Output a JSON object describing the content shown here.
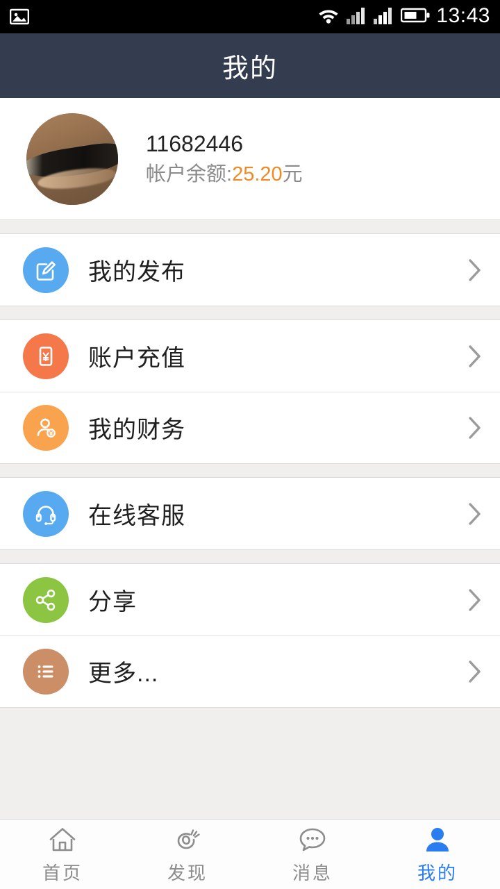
{
  "status_bar": {
    "time": "13:43",
    "icons": [
      "photo-icon",
      "wifi-icon",
      "signal-icon-1",
      "signal-icon-2",
      "battery-icon"
    ]
  },
  "header": {
    "title": "我的"
  },
  "profile": {
    "avatar_alt": "user-avatar-photo",
    "username": "11682446",
    "balance_label": "帐户余额:",
    "balance_amount": "25.20",
    "balance_unit": "元",
    "balance_color": "#f08a24"
  },
  "menu_groups": [
    {
      "items": [
        {
          "label": "我的发布",
          "icon": "edit-document-icon",
          "color": "#58aaf0",
          "chevron": "chevron-right-icon"
        }
      ]
    },
    {
      "items": [
        {
          "label": "账户充值",
          "icon": "yuan-note-icon",
          "color": "#f4784a",
          "chevron": "chevron-right-icon"
        },
        {
          "label": "我的财务",
          "icon": "user-coin-icon",
          "color": "#f9a34e",
          "chevron": "chevron-right-icon"
        }
      ]
    },
    {
      "items": [
        {
          "label": "在线客服",
          "icon": "headset-icon",
          "color": "#58aaf0",
          "chevron": "chevron-right-icon"
        }
      ]
    },
    {
      "items": [
        {
          "label": "分享",
          "icon": "share-nodes-icon",
          "color": "#8cc542",
          "chevron": "chevron-right-icon"
        },
        {
          "label": "更多...",
          "icon": "list-lines-icon",
          "color": "#cc8e66",
          "chevron": "chevron-right-icon"
        }
      ]
    }
  ],
  "tabbar": {
    "active_color": "#2a7df0",
    "inactive_color": "#8d8d8d",
    "items": [
      {
        "label": "首页",
        "icon": "home-icon",
        "active": false
      },
      {
        "label": "发现",
        "icon": "eye-discover-icon",
        "active": false
      },
      {
        "label": "消息",
        "icon": "chat-bubble-icon",
        "active": false
      },
      {
        "label": "我的",
        "icon": "person-icon",
        "active": true
      }
    ]
  }
}
